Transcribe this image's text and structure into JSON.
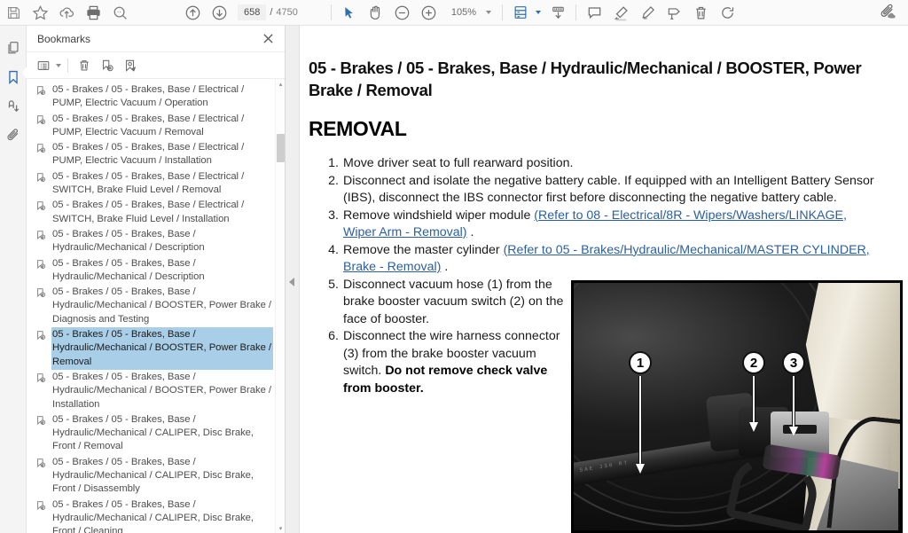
{
  "toolbar": {
    "save_label": "save-icon",
    "bookmark_label": "star-icon",
    "upload_label": "cloud-upload-icon",
    "print_label": "print-icon",
    "search_label": "search-icon",
    "prev_page_label": "arrow-up-circle-icon",
    "next_page_label": "arrow-down-circle-icon",
    "page_current": "658",
    "page_separator": "/",
    "page_total": "4750",
    "select_tool_label": "cursor-icon",
    "pan_tool_label": "hand-icon",
    "zoom_out_label": "zoom-out-icon",
    "zoom_in_label": "zoom-in-icon",
    "zoom_value": "105%",
    "page_fit_label": "page-fit-icon",
    "scroll_mode_label": "scroll-mode-icon",
    "comment_label": "comment-icon",
    "highlight_label": "highlighter-icon",
    "ink_label": "pen-icon",
    "stamp_label": "stamp-icon",
    "delete_label": "trash-icon",
    "rotate_label": "rotate-icon",
    "attach_label": "attachment-cloud-icon"
  },
  "rail": {
    "items": [
      {
        "name": "pages-icon",
        "label": "Pages"
      },
      {
        "name": "bookmarks-icon",
        "label": "Bookmarks"
      },
      {
        "name": "signature-icon",
        "label": "Signatures"
      },
      {
        "name": "attachments-icon",
        "label": "Attachments"
      }
    ],
    "active_index": 1
  },
  "panel": {
    "title": "Bookmarks",
    "close_label": "✕",
    "tools": [
      {
        "name": "bookmark-options-icon",
        "label": "Options"
      },
      {
        "name": "delete-bookmark-icon",
        "label": "Delete"
      },
      {
        "name": "new-bookmark-icon",
        "label": "New Bookmark"
      },
      {
        "name": "edit-bookmark-icon",
        "label": "Edit Bookmark"
      }
    ],
    "bookmarks": [
      {
        "text": "05 - Brakes / 05 - Brakes, Base / Electrical / PUMP, Electric Vacuum / Operation",
        "selected": false
      },
      {
        "text": "05 - Brakes / 05 - Brakes, Base / Electrical / PUMP, Electric Vacuum / Removal",
        "selected": false
      },
      {
        "text": "05 - Brakes / 05 - Brakes, Base / Electrical / PUMP, Electric Vacuum / Installation",
        "selected": false
      },
      {
        "text": "05 - Brakes / 05 - Brakes, Base / Electrical / SWITCH, Brake Fluid Level / Removal",
        "selected": false
      },
      {
        "text": "05 - Brakes / 05 - Brakes, Base / Electrical / SWITCH, Brake Fluid Level / Installation",
        "selected": false
      },
      {
        "text": "05 - Brakes / 05 - Brakes, Base / Hydraulic/Mechanical / Description",
        "selected": false
      },
      {
        "text": "05 - Brakes / 05 - Brakes, Base / Hydraulic/Mechanical / Description",
        "selected": false
      },
      {
        "text": "05 - Brakes / 05 - Brakes, Base / Hydraulic/Mechanical / BOOSTER, Power Brake / Diagnosis and Testing",
        "selected": false
      },
      {
        "text": "05 - Brakes / 05 - Brakes, Base / Hydraulic/Mechanical / BOOSTER, Power Brake / Removal",
        "selected": true
      },
      {
        "text": "05 - Brakes / 05 - Brakes, Base / Hydraulic/Mechanical / BOOSTER, Power Brake / Installation",
        "selected": false
      },
      {
        "text": "05 - Brakes / 05 - Brakes, Base / Hydraulic/Mechanical / CALIPER, Disc Brake, Front / Removal",
        "selected": false
      },
      {
        "text": "05 - Brakes / 05 - Brakes, Base / Hydraulic/Mechanical / CALIPER, Disc Brake, Front / Disassembly",
        "selected": false
      },
      {
        "text": "05 - Brakes / 05 - Brakes, Base / Hydraulic/Mechanical / CALIPER, Disc Brake, Front / Cleaning",
        "selected": false
      }
    ],
    "scroll_up_label": "▴",
    "scroll_down_label": "▾"
  },
  "document": {
    "breadcrumb_heading": "05 - Brakes / 05 - Brakes, Base / Hydraulic/Mechanical / BOOSTER, Power Brake / Removal",
    "section_heading": "REMOVAL",
    "steps": [
      {
        "parts": [
          {
            "t": "text",
            "v": "Move driver seat to full rearward position."
          }
        ]
      },
      {
        "parts": [
          {
            "t": "text",
            "v": "Disconnect and isolate the negative battery cable. If equipped with an Intelligent Battery Sensor (IBS), disconnect the IBS connector first before disconnecting the negative battery cable."
          }
        ]
      },
      {
        "parts": [
          {
            "t": "text",
            "v": "Remove windshield wiper module "
          },
          {
            "t": "link",
            "v": "(Refer to 08 - Electrical/8R - Wipers/Washers/LINKAGE, Wiper Arm - Removal)"
          },
          {
            "t": "text",
            "v": " ."
          }
        ]
      },
      {
        "parts": [
          {
            "t": "text",
            "v": "Remove the master cylinder "
          },
          {
            "t": "link",
            "v": "(Refer to 05 - Brakes/Hydraulic/Mechanical/MASTER CYLINDER, Brake - Removal)"
          },
          {
            "t": "text",
            "v": " ."
          }
        ]
      },
      {
        "parts": [
          {
            "t": "text",
            "v": "Disconnect vacuum hose (1) from the brake booster vacuum switch (2) on the face of booster."
          }
        ]
      },
      {
        "parts": [
          {
            "t": "text",
            "v": "Disconnect the wire harness connector (3) from the brake booster vacuum switch. "
          },
          {
            "t": "bold",
            "v": "Do not remove check valve from booster."
          }
        ]
      }
    ],
    "photo": {
      "alt": "Brake booster vacuum switch and connector photo",
      "callouts": [
        "1",
        "2",
        "3"
      ]
    }
  },
  "colors": {
    "accent_blue": "#2f6fad",
    "link_blue": "#2b5f9e",
    "selection_blue": "#a8cee8",
    "toolbar_bg": "#fafafa",
    "rail_bg": "#f4f4f4"
  }
}
